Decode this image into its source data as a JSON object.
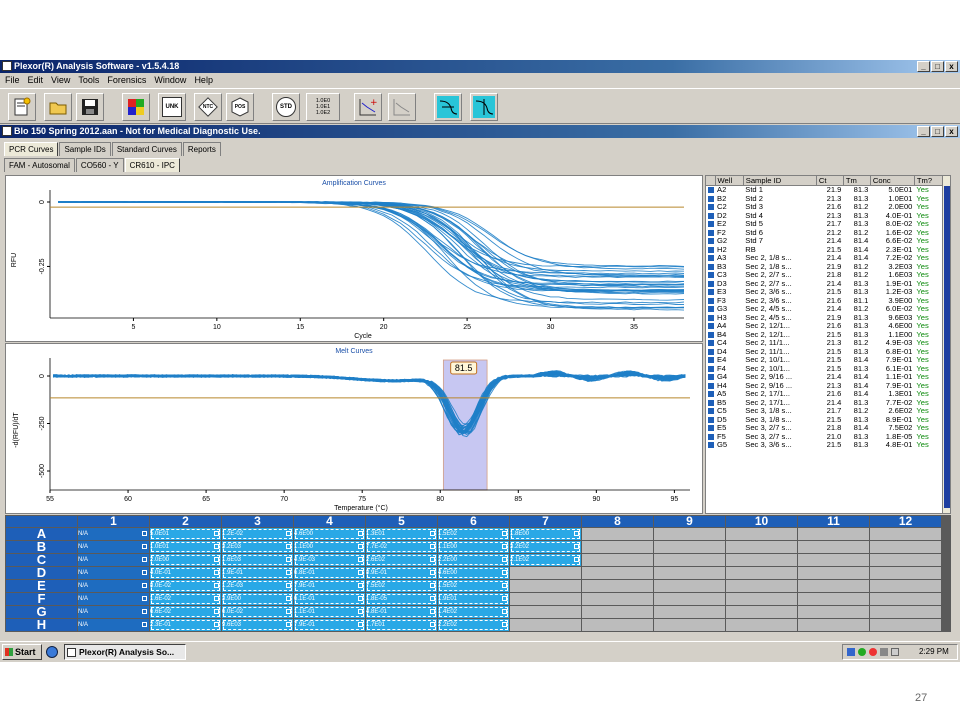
{
  "app": {
    "title": "Plexor(R) Analysis Software - v1.5.4.18",
    "menu": [
      "File",
      "Edit",
      "View",
      "Tools",
      "Forensics",
      "Window",
      "Help"
    ],
    "window_buttons": [
      "_",
      "□",
      "x"
    ]
  },
  "toolbar": {
    "unk": "UNK",
    "ntc": "NTC",
    "pos": "POS",
    "std": "STD",
    "std_values": [
      "1.0E0",
      "1.0E1",
      "1.0E2"
    ]
  },
  "document": {
    "title": "BIo 150 Spring 2012.aan - Not for Medical Diagnostic Use.",
    "tabs": [
      "PCR Curves",
      "Sample IDs",
      "Standard Curves",
      "Reports"
    ],
    "dye_tabs": [
      "FAM - Autosomal",
      "CO560 - Y",
      "CR610 - IPC"
    ]
  },
  "chart_data": [
    {
      "type": "line",
      "title": "Amplification Curves",
      "xlabel": "Cycle",
      "ylabel": "RFU",
      "xlim": [
        0,
        38
      ],
      "x_ticks": [
        5,
        10,
        15,
        20,
        25,
        30,
        35
      ],
      "y_ticks": [
        0,
        -0.25
      ],
      "threshold": -0.02,
      "curve_model": {
        "start": 0,
        "series_count": 31,
        "onset_cycle_range": [
          22.5,
          27
        ],
        "plateau_range": [
          -0.24,
          -0.42
        ]
      }
    },
    {
      "type": "line",
      "title": "Melt Curves",
      "xlabel": "Temperature (°C)",
      "ylabel": "-d(RFU)/dT",
      "xlim": [
        55,
        96
      ],
      "x_ticks": [
        55,
        60,
        65,
        70,
        75,
        80,
        85,
        90,
        95
      ],
      "y_ticks": [
        0,
        -250,
        -500
      ],
      "threshold": -115,
      "peak_label": "81.5",
      "peak_temp": 81.5,
      "selection_range": [
        80.2,
        83.0
      ],
      "curve_model": {
        "series_count": 31,
        "peak_depth_range": [
          -250,
          -310
        ]
      }
    }
  ],
  "well_table": {
    "headers": [
      "Well",
      "Sample ID",
      "Ct",
      "Tm",
      "Conc",
      "Tm?"
    ],
    "rows": [
      [
        "A2",
        "Std 1",
        "21.9",
        "81.3",
        "5.0E01",
        "Yes"
      ],
      [
        "B2",
        "Std 2",
        "21.3",
        "81.3",
        "1.0E01",
        "Yes"
      ],
      [
        "C2",
        "Std 3",
        "21.6",
        "81.2",
        "2.0E00",
        "Yes"
      ],
      [
        "D2",
        "Std 4",
        "21.3",
        "81.3",
        "4.0E-01",
        "Yes"
      ],
      [
        "E2",
        "Std 5",
        "21.7",
        "81.3",
        "8.0E-02",
        "Yes"
      ],
      [
        "F2",
        "Std 6",
        "21.2",
        "81.2",
        "1.6E-02",
        "Yes"
      ],
      [
        "G2",
        "Std 7",
        "21.4",
        "81.4",
        "6.6E-02",
        "Yes"
      ],
      [
        "H2",
        "RB",
        "21.5",
        "81.4",
        "2.3E-01",
        "Yes"
      ],
      [
        "A3",
        "Sec 2, 1/8 s...",
        "21.4",
        "81.4",
        "7.2E-02",
        "Yes"
      ],
      [
        "B3",
        "Sec 2, 1/8 s...",
        "21.9",
        "81.2",
        "3.2E03",
        "Yes"
      ],
      [
        "C3",
        "Sec 2, 2/7 s...",
        "21.8",
        "81.2",
        "1.6E03",
        "Yes"
      ],
      [
        "D3",
        "Sec 2, 2/7 s...",
        "21.4",
        "81.3",
        "1.9E-01",
        "Yes"
      ],
      [
        "E3",
        "Sec 2, 3/6 s...",
        "21.5",
        "81.3",
        "1.2E-03",
        "Yes"
      ],
      [
        "F3",
        "Sec 2, 3/6 s...",
        "21.6",
        "81.1",
        "3.9E00",
        "Yes"
      ],
      [
        "G3",
        "Sec 2, 4/5 s...",
        "21.4",
        "81.2",
        "6.0E-02",
        "Yes"
      ],
      [
        "H3",
        "Sec 2, 4/5 s...",
        "21.9",
        "81.3",
        "9.6E03",
        "Yes"
      ],
      [
        "A4",
        "Sec 2, 12/1...",
        "21.6",
        "81.3",
        "4.6E00",
        "Yes"
      ],
      [
        "B4",
        "Sec 2, 12/1...",
        "21.5",
        "81.3",
        "1.1E00",
        "Yes"
      ],
      [
        "C4",
        "Sec 2, 11/1...",
        "21.3",
        "81.2",
        "4.9E-03",
        "Yes"
      ],
      [
        "D4",
        "Sec 2, 11/1...",
        "21.5",
        "81.3",
        "6.8E-01",
        "Yes"
      ],
      [
        "E4",
        "Sec 2, 10/1...",
        "21.5",
        "81.4",
        "7.9E-01",
        "Yes"
      ],
      [
        "F4",
        "Sec 2, 10/1...",
        "21.5",
        "81.3",
        "6.1E-01",
        "Yes"
      ],
      [
        "G4",
        "Sec 2, 9/16 ...",
        "21.4",
        "81.4",
        "1.1E-01",
        "Yes"
      ],
      [
        "H4",
        "Sec 2, 9/16 ...",
        "21.3",
        "81.4",
        "7.9E-01",
        "Yes"
      ],
      [
        "A5",
        "Sec 2, 17/1...",
        "21.6",
        "81.4",
        "1.3E01",
        "Yes"
      ],
      [
        "B5",
        "Sec 2, 17/1...",
        "21.4",
        "81.3",
        "7.7E-02",
        "Yes"
      ],
      [
        "C5",
        "Sec 3, 1/8 s...",
        "21.7",
        "81.2",
        "2.6E02",
        "Yes"
      ],
      [
        "D5",
        "Sec 3, 1/8 s...",
        "21.5",
        "81.3",
        "8.9E-01",
        "Yes"
      ],
      [
        "E5",
        "Sec 3, 2/7 s...",
        "21.8",
        "81.4",
        "7.5E02",
        "Yes"
      ],
      [
        "F5",
        "Sec 3, 2/7 s...",
        "21.0",
        "81.3",
        "1.8E-05",
        "Yes"
      ],
      [
        "G5",
        "Sec 3, 3/6 s...",
        "21.5",
        "81.3",
        "4.8E-01",
        "Yes"
      ]
    ]
  },
  "plate": {
    "columns": [
      "1",
      "2",
      "3",
      "4",
      "5",
      "6",
      "7",
      "8",
      "9",
      "10",
      "11",
      "12"
    ],
    "rows": [
      {
        "label": "A",
        "cells": [
          "N/A",
          "5.0E01",
          "1.2E-02",
          "4.6E00",
          "1.3E01",
          "1.5E02",
          "1.8E00",
          "",
          "",
          "",
          "",
          ""
        ]
      },
      {
        "label": "B",
        "cells": [
          "N/A",
          "1.0E01",
          "3.2E03",
          "1.1E00",
          "7.7E-02",
          "1.1E00",
          "3.2E02",
          "",
          "",
          "",
          "",
          ""
        ]
      },
      {
        "label": "C",
        "cells": [
          "N/A",
          "2.0E00",
          "1.6E03",
          "4.9E-03",
          "2.6E02",
          "2.2E00",
          "2.1E02",
          "",
          "",
          "",
          "",
          ""
        ]
      },
      {
        "label": "D",
        "cells": [
          "N/A",
          "4.0E-01",
          "1.9E-01",
          "6.8E-01",
          "8.9E-01",
          "4.6E00",
          "",
          "",
          "",
          "",
          "",
          ""
        ]
      },
      {
        "label": "E",
        "cells": [
          "N/A",
          "8.0E-02",
          "1.2E-03",
          "7.9E-01",
          "7.5E02",
          "1.5E02",
          "",
          "",
          "",
          "",
          "",
          ""
        ]
      },
      {
        "label": "F",
        "cells": [
          "N/A",
          "1.6E-02",
          "3.9E00",
          "6.1E-01",
          "1.8E-05",
          "1.9E01",
          "",
          "",
          "",
          "",
          "",
          ""
        ]
      },
      {
        "label": "G",
        "cells": [
          "N/A",
          "6.6E-02",
          "6.0E-02",
          "1.1E-01",
          "4.8E-01",
          "1.4E02",
          "",
          "",
          "",
          "",
          "",
          ""
        ]
      },
      {
        "label": "H",
        "cells": [
          "N/A",
          "2.3E-01",
          "9.6E03",
          "7.9E-01",
          "1.7E01",
          "2.2E02",
          "",
          "",
          "",
          "",
          "",
          ""
        ]
      }
    ]
  },
  "taskbar": {
    "start": "Start",
    "task": "Plexor(R) Analysis So...",
    "time": "2:29 PM"
  },
  "page_number": "27",
  "colors": {
    "curve": "#1f7fc8",
    "threshold": "#b8862b",
    "selection": "#9a9ae8",
    "plate_header": "#1e5fb8",
    "plate_value_cell": "#29a8e6",
    "yes_text": "#0a8a0a"
  }
}
